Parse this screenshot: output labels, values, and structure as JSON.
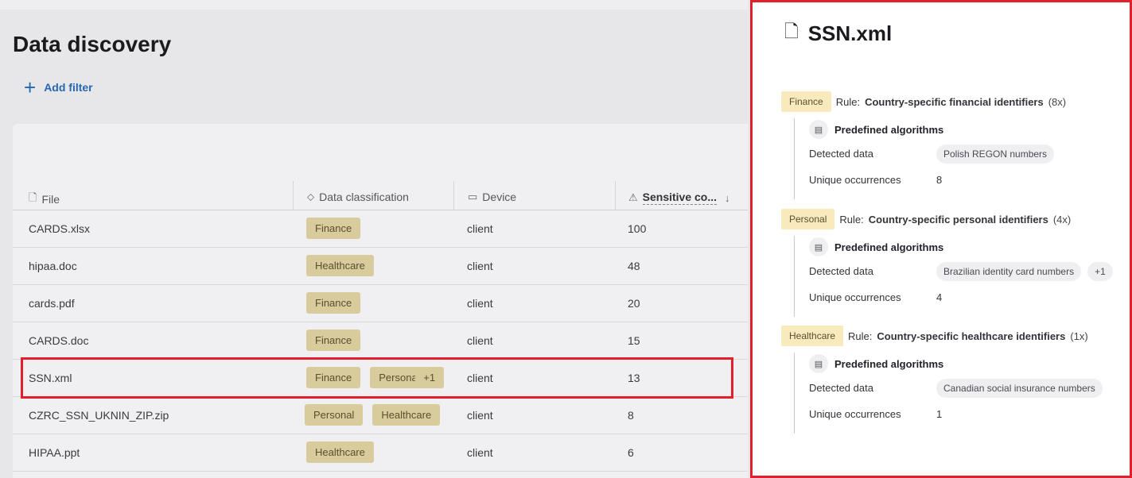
{
  "page": {
    "title": "Data discovery",
    "add_filter": "Add filter"
  },
  "table": {
    "headers": {
      "file": "File",
      "classification": "Data classification",
      "device": "Device",
      "sensitive": "Sensitive co..."
    },
    "rows": [
      {
        "file": "CARDS.xlsx",
        "tags": [
          "Finance"
        ],
        "extra": "",
        "device": "client",
        "count": "100"
      },
      {
        "file": "hipaa.doc",
        "tags": [
          "Healthcare"
        ],
        "extra": "",
        "device": "client",
        "count": "48"
      },
      {
        "file": "cards.pdf",
        "tags": [
          "Finance"
        ],
        "extra": "",
        "device": "client",
        "count": "20"
      },
      {
        "file": "CARDS.doc",
        "tags": [
          "Finance"
        ],
        "extra": "",
        "device": "client",
        "count": "15"
      },
      {
        "file": "SSN.xml",
        "tags": [
          "Finance",
          "Personal"
        ],
        "extra": "+1",
        "device": "client",
        "count": "13"
      },
      {
        "file": "CZRC_SSN_UKNIN_ZIP.zip",
        "tags": [
          "Personal",
          "Healthcare"
        ],
        "extra": "",
        "device": "client",
        "count": "8"
      },
      {
        "file": "HIPAA.ppt",
        "tags": [
          "Healthcare"
        ],
        "extra": "",
        "device": "client",
        "count": "6"
      }
    ]
  },
  "panel": {
    "title": "SSN.xml",
    "sections": [
      {
        "tag": "Finance",
        "rule_label": "Rule:",
        "rule": "Country-specific financial identifiers",
        "count": "(8x)",
        "algorithm": "Predefined algorithms",
        "detected_label": "Detected data",
        "detected": [
          "Polish REGON numbers"
        ],
        "unique_label": "Unique occurrences",
        "unique": "8"
      },
      {
        "tag": "Personal",
        "rule_label": "Rule:",
        "rule": "Country-specific personal identifiers",
        "count": "(4x)",
        "algorithm": "Predefined algorithms",
        "detected_label": "Detected data",
        "detected": [
          "Brazilian identity card numbers",
          "+1"
        ],
        "unique_label": "Unique occurrences",
        "unique": "4"
      },
      {
        "tag": "Healthcare",
        "rule_label": "Rule:",
        "rule": "Country-specific healthcare identifiers",
        "count": "(1x)",
        "algorithm": "Predefined algorithms",
        "detected_label": "Detected data",
        "detected": [
          "Canadian social insurance numbers"
        ],
        "unique_label": "Unique occurrences",
        "unique": "1"
      }
    ]
  },
  "colors": {
    "highlight": "#e0202a",
    "tag_bg": "#d8cb9c",
    "panel_tag_bg": "#f8eabc",
    "link": "#2766b0"
  },
  "icons": [
    "file-icon",
    "tag-icon",
    "laptop-icon",
    "warning-icon",
    "sort-down-icon",
    "plus-icon",
    "algorithm-icon"
  ]
}
